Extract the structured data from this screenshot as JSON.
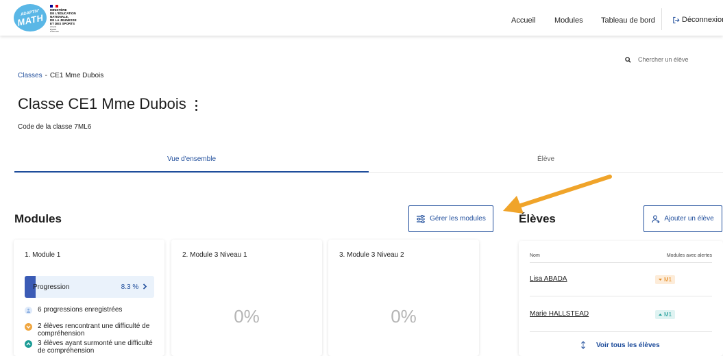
{
  "header": {
    "logo": {
      "line1": "ADAPTIV'",
      "line2": "MATH"
    },
    "ministry": {
      "name": "MINISTÈRE\nDE L'ÉDUCATION\nNATIONALE,\nDE LA JEUNESSE\nET DES SPORTS",
      "motto": "Liberté\nÉgalité\nFraternité"
    },
    "nav": [
      "Accueil",
      "Modules",
      "Tableau de bord"
    ],
    "logout_label": "Déconnexion"
  },
  "search": {
    "placeholder": "Chercher un élève",
    "icon": "search-icon"
  },
  "breadcrumb": {
    "root": "Classes",
    "separator": "-",
    "current": "CE1 Mme Dubois"
  },
  "page": {
    "title": "Classe CE1 Mme Dubois",
    "class_code": "Code de la classe 7ML6"
  },
  "tabs": [
    {
      "label": "Vue d'ensemble",
      "active": true
    },
    {
      "label": "Élève",
      "active": false
    }
  ],
  "modules_section": {
    "title": "Modules",
    "manage_button": "Gérer les modules",
    "cards": [
      {
        "title": "1. Module 1",
        "progress_label": "Progression",
        "progress_value": "8.3 %",
        "progress_fraction": 0.083,
        "stats": [
          {
            "text": "6 progressions enregistrées",
            "icon": "person-icon",
            "color": "#c7dcf5"
          },
          {
            "text": "2 élèves rencontrant une difficulté de compréhension",
            "icon": "chevron-down-icon",
            "color": "#f0a640"
          },
          {
            "text": "3 élèves ayant surmonté une difficulté de compréhension",
            "icon": "chevron-up-icon",
            "color": "#1c9c96"
          }
        ]
      },
      {
        "title": "2. Module 3 Niveau 1",
        "percent": "0%"
      },
      {
        "title": "3. Module 3 Niveau 2",
        "percent": "0%"
      }
    ]
  },
  "students_section": {
    "title": "Élèves",
    "add_button": "Ajouter un élève",
    "columns": [
      "Nom",
      "Modules avec alertes"
    ],
    "rows": [
      {
        "name": "Lisa ABADA",
        "badge": "M1",
        "trend": "down"
      },
      {
        "name": "Marie HALLSTEAD",
        "badge": "M1",
        "trend": "up"
      }
    ],
    "see_all": "Voir tous les élèves"
  },
  "colors": {
    "primary": "#1f4d9b",
    "accent": "#f0a42a",
    "logo": "#5ab7e6"
  }
}
